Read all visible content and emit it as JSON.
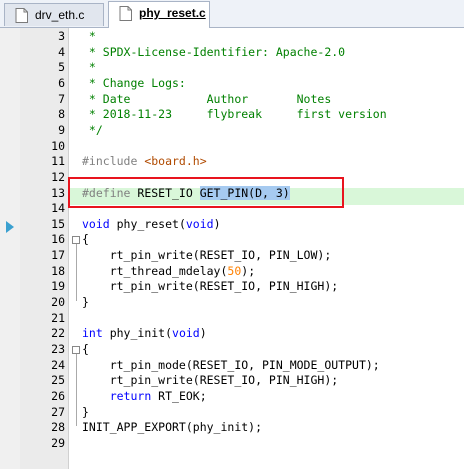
{
  "tabs": [
    {
      "label": "drv_eth.c",
      "active": false
    },
    {
      "label": "phy_reset.c",
      "active": true
    }
  ],
  "lines": [
    {
      "n": "3",
      "parts": [
        {
          "t": " *",
          "c": "cm"
        }
      ]
    },
    {
      "n": "4",
      "parts": [
        {
          "t": " * SPDX-License-Identifier: Apache-2.0",
          "c": "cm"
        }
      ]
    },
    {
      "n": "5",
      "parts": [
        {
          "t": " *",
          "c": "cm"
        }
      ]
    },
    {
      "n": "6",
      "parts": [
        {
          "t": " * Change Logs:",
          "c": "cm"
        }
      ]
    },
    {
      "n": "7",
      "parts": [
        {
          "t": " * Date           Author       Notes",
          "c": "cm"
        }
      ]
    },
    {
      "n": "8",
      "parts": [
        {
          "t": " * 2018-11-23     flybreak     first version",
          "c": "cm"
        }
      ]
    },
    {
      "n": "9",
      "parts": [
        {
          "t": " */",
          "c": "cm"
        }
      ]
    },
    {
      "n": "10",
      "parts": []
    },
    {
      "n": "11",
      "parts": [
        {
          "t": "#include ",
          "c": "pp"
        },
        {
          "t": "<board.h>",
          "c": "pv"
        }
      ]
    },
    {
      "n": "12",
      "parts": []
    },
    {
      "n": "13",
      "parts": [
        {
          "t": "#define ",
          "c": "pp"
        },
        {
          "t": "RESET_IO ",
          "c": ""
        },
        {
          "t": "GET_PIN(D, 3)",
          "c": "sel"
        }
      ]
    },
    {
      "n": "14",
      "parts": []
    },
    {
      "n": "15",
      "parts": [
        {
          "t": "void",
          "c": "kw"
        },
        {
          "t": " phy_reset(",
          "c": ""
        },
        {
          "t": "void",
          "c": "kw"
        },
        {
          "t": ")",
          "c": ""
        }
      ]
    },
    {
      "n": "16",
      "parts": [
        {
          "t": "{",
          "c": ""
        }
      ]
    },
    {
      "n": "17",
      "parts": [
        {
          "t": "    rt_pin_write(RESET_IO, PIN_LOW);",
          "c": ""
        }
      ]
    },
    {
      "n": "18",
      "parts": [
        {
          "t": "    rt_thread_mdelay(",
          "c": ""
        },
        {
          "t": "50",
          "c": "num"
        },
        {
          "t": ");",
          "c": ""
        }
      ]
    },
    {
      "n": "19",
      "parts": [
        {
          "t": "    rt_pin_write(RESET_IO, PIN_HIGH);",
          "c": ""
        }
      ]
    },
    {
      "n": "20",
      "parts": [
        {
          "t": "}",
          "c": ""
        }
      ]
    },
    {
      "n": "21",
      "parts": []
    },
    {
      "n": "22",
      "parts": [
        {
          "t": "int",
          "c": "kw"
        },
        {
          "t": " phy_init(",
          "c": ""
        },
        {
          "t": "void",
          "c": "kw"
        },
        {
          "t": ")",
          "c": ""
        }
      ]
    },
    {
      "n": "23",
      "parts": [
        {
          "t": "{",
          "c": ""
        }
      ]
    },
    {
      "n": "24",
      "parts": [
        {
          "t": "    rt_pin_mode(RESET_IO, PIN_MODE_OUTPUT);",
          "c": ""
        }
      ]
    },
    {
      "n": "25",
      "parts": [
        {
          "t": "    rt_pin_write(RESET_IO, PIN_HIGH);",
          "c": ""
        }
      ]
    },
    {
      "n": "26",
      "parts": [
        {
          "t": "    ",
          "c": ""
        },
        {
          "t": "return",
          "c": "kw"
        },
        {
          "t": " RT_EOK;",
          "c": ""
        }
      ]
    },
    {
      "n": "27",
      "parts": [
        {
          "t": "}",
          "c": ""
        }
      ]
    },
    {
      "n": "28",
      "parts": [
        {
          "t": "INIT_APP_EXPORT(phy_init);",
          "c": ""
        }
      ]
    },
    {
      "n": "29",
      "parts": []
    }
  ],
  "highlight_color": "#e8141e"
}
